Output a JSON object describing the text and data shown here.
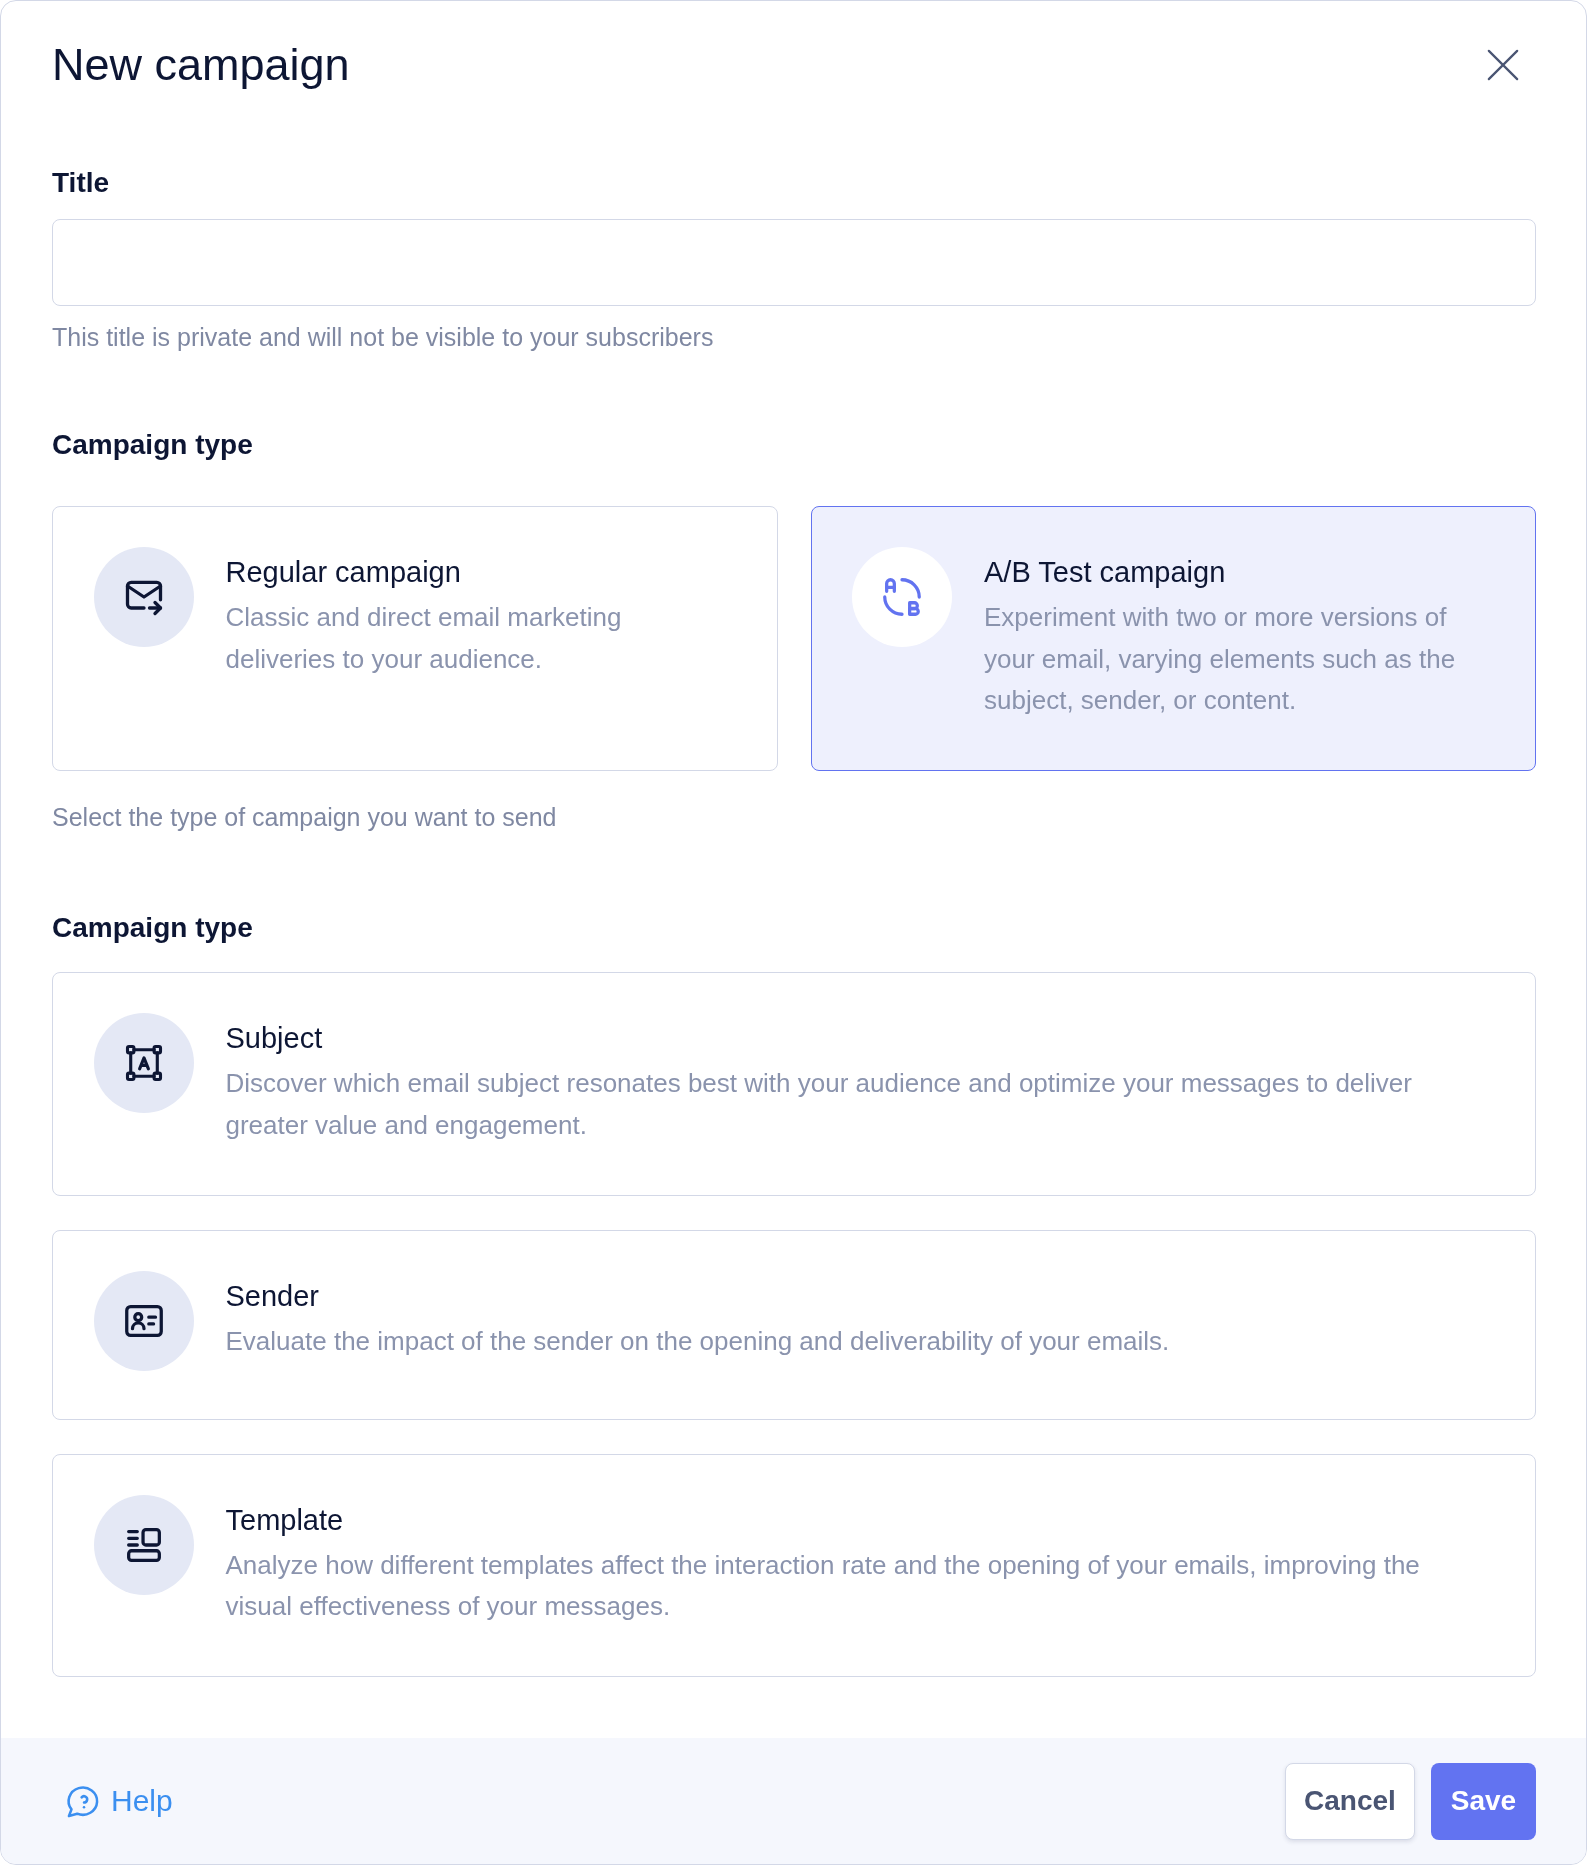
{
  "dialog": {
    "title": "New campaign"
  },
  "title_field": {
    "label": "Title",
    "hint": "This title is private and will not be visible to your subscribers"
  },
  "campaign_type": {
    "label": "Campaign type",
    "options": [
      {
        "title": "Regular campaign",
        "description": "Classic and direct email marketing deliveries to your audience.",
        "selected": false
      },
      {
        "title": "A/B Test campaign",
        "description": "Experiment with two or more versions of your email, varying elements such as the subject, sender, or content.",
        "selected": true
      }
    ],
    "hint": "Select the type of campaign you want to send"
  },
  "test_type": {
    "label": "Campaign type",
    "options": [
      {
        "title": "Subject",
        "description": "Discover which email subject resonates best with your audience and optimize your messages to deliver greater value and engagement.",
        "selected": false
      },
      {
        "title": "Sender",
        "description": "Evaluate the impact of the sender on the opening and deliverability of your emails.",
        "selected": false
      },
      {
        "title": "Template",
        "description": "Analyze how different templates affect the interaction rate and the opening of your emails, improving the visual effectiveness of your messages.",
        "selected": false
      }
    ]
  },
  "footer": {
    "help": "Help",
    "buttons": [
      {
        "label": "Cancel",
        "kind": "secondary"
      },
      {
        "label": "Save",
        "kind": "primary"
      }
    ]
  }
}
